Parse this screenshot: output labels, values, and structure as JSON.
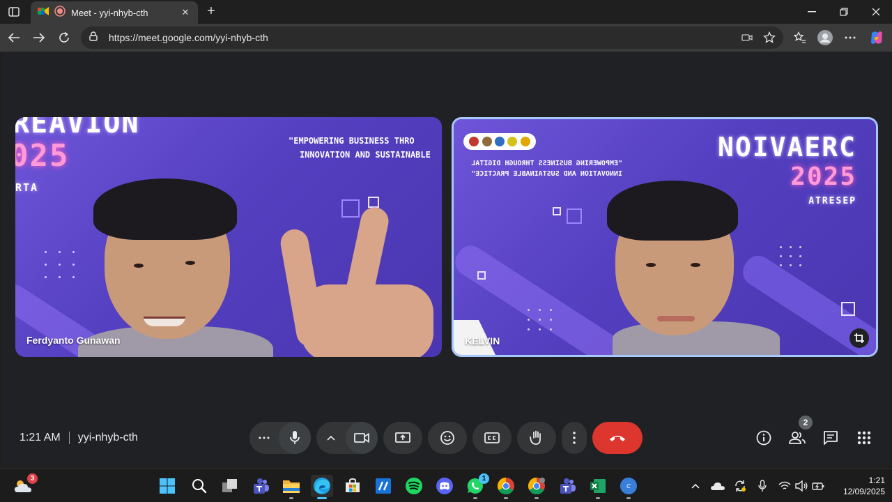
{
  "browser": {
    "tab_title": "Meet - yyi-nhyb-cth",
    "url": "https://meet.google.com/yyi-nhyb-cth"
  },
  "tiles": [
    {
      "participant": "Ferdyanto Gunawan",
      "bg_title_partial": "REAVION",
      "bg_year_partial": "025",
      "bg_role_partial": "RTA",
      "tagline_line1": "\"EMPOWERING BUSINESS THRO",
      "tagline_line2": "INNOVATION AND SUSTAINABLE"
    },
    {
      "participant": "KELVIN",
      "bg_title": "NOIVAERC",
      "bg_year": "2025",
      "bg_role": "ATRESEP",
      "tagline_line1": "\"EMPOWERING BUSINESS THROUGH DIGITAL",
      "tagline_line2": "INNOVATION AND SUSTAINABLE PRACTICE\""
    }
  ],
  "meeting": {
    "time": "1:21 AM",
    "code": "yyi-nhyb-cth",
    "participant_count": "2"
  },
  "colors": {
    "end_call": "#dc362e",
    "active_speaker_border": "#a8c7fa",
    "control_bg": "#333537"
  },
  "taskbar": {
    "weather_badge": "3",
    "whatsapp_badge": "1",
    "time": "1:21",
    "date": "12/09/2025"
  }
}
